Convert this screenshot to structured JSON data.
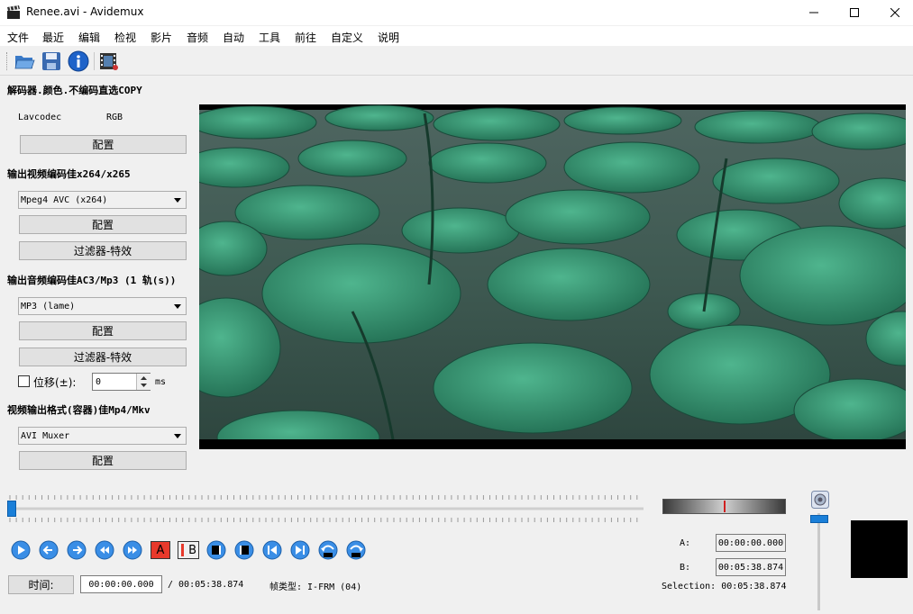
{
  "window": {
    "title": "Renee.avi - Avidemux"
  },
  "menu": [
    "文件",
    "最近",
    "编辑",
    "检视",
    "影片",
    "音频",
    "自动",
    "工具",
    "前往",
    "自定义",
    "说明"
  ],
  "decoder": {
    "header": "解码器.颜色.不编码直选COPY",
    "codec": "Lavcodec",
    "colorspace": "RGB",
    "configure": "配置"
  },
  "video_output": {
    "header": "输出视频编码佳x264/x265",
    "selected": "Mpeg4 AVC (x264)",
    "configure": "配置",
    "filters": "过滤器-特效"
  },
  "audio_output": {
    "header": "输出音频编码佳AC3/Mp3 (1 轨(s))",
    "selected": "MP3 (lame)",
    "configure": "配置",
    "filters": "过滤器-特效",
    "shift_label": "位移(±):",
    "shift_value": "0",
    "shift_unit": "ms"
  },
  "container": {
    "header": "视频输出格式(容器)佳Mp4/Mkv",
    "selected": "AVI Muxer",
    "configure": "配置"
  },
  "timeline": {
    "position": 0
  },
  "markers": {
    "a_label": "A",
    "b_label": "B"
  },
  "time": {
    "button": "时间:",
    "current": "00:00:00.000",
    "total": "/ 00:05:38.874",
    "frame_type": "帧类型: I-FRM (04)"
  },
  "selection": {
    "a_label": "A:",
    "a_value": "00:00:00.000",
    "b_label": "B:",
    "b_value": "00:05:38.874",
    "selection_text": "Selection: 00:05:38.874"
  }
}
